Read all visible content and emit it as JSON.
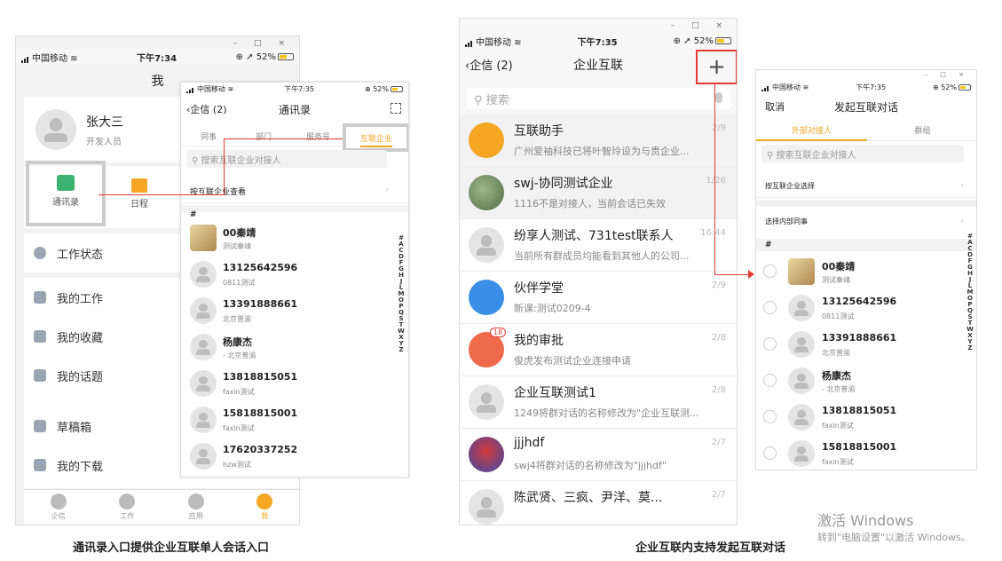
{
  "colors": {
    "accent": "#f5a623",
    "red": "#e53935",
    "gray_bg": "#f2f2f2"
  },
  "status": {
    "carrier": "中国移动",
    "time1": "下午7:34",
    "time2": "下午7:35",
    "time3": "下午7:35",
    "time4": "下午7:35",
    "battery": "52%"
  },
  "window_controls": "–  □  ×",
  "me": {
    "title": "我",
    "name": "张大三",
    "role": "开发人员",
    "shortcuts": [
      "通讯录",
      "日程"
    ],
    "menu": [
      "工作状态",
      "我的工作",
      "我的收藏",
      "我的话题",
      "草稿箱",
      "我的下载"
    ],
    "tabs": [
      "企信",
      "工作",
      "应用",
      "我"
    ]
  },
  "contacts": {
    "back": "企信 (2)",
    "title": "通讯录",
    "tabs": [
      "同事",
      "部门",
      "服务号",
      "互联企业"
    ],
    "search_placeholder": "搜索互联企业对接人",
    "browse": "按互联企业查看",
    "section": "#",
    "items": [
      {
        "name": "00秦靖",
        "sub": "测试秦靖"
      },
      {
        "name": "13125642596",
        "sub": "0811测试"
      },
      {
        "name": "13391888661",
        "sub": "北京普渝"
      },
      {
        "name": "杨康杰",
        "sub": "- 北京普渝"
      },
      {
        "name": "13818815051",
        "sub": "faxin测试"
      },
      {
        "name": "15818815001",
        "sub": "faxin测试"
      },
      {
        "name": "17620337252",
        "sub": "hzw测试"
      }
    ],
    "index": [
      "#",
      "A",
      "C",
      "D",
      "F",
      "G",
      "H",
      "J",
      "L",
      "M",
      "O",
      "P",
      "Q",
      "S",
      "T",
      "W",
      "X",
      "Y",
      "Z"
    ]
  },
  "interconnect": {
    "back": "企信 (2)",
    "title": "企业互联",
    "add": "+",
    "search": "搜索",
    "chats": [
      {
        "title": "互联助手",
        "sub": "广州爱袖科技已将叶智玲设为与贵企业...",
        "date": "2/9",
        "badge": ""
      },
      {
        "title": "swj-协同测试企业",
        "sub": "1116不是对接人，当前会话已失效",
        "date": "1/26",
        "badge": ""
      },
      {
        "title": "纷享人测试、731test联系人",
        "sub": "当前所有群成员均能看到其他人的公司...",
        "date": "16:44",
        "badge": ""
      },
      {
        "title": "伙伴学堂",
        "sub": "新课:测试0209-4",
        "date": "2/9",
        "badge": ""
      },
      {
        "title": "我的审批",
        "sub": "俊虎发布测试企业连接申请",
        "date": "2/8",
        "badge": "18"
      },
      {
        "title": "企业互联测试1",
        "sub": "1249将群对话的名称修改为\"企业互联测...",
        "date": "2/8",
        "badge": ""
      },
      {
        "title": "jjjhdf",
        "sub": "swj4将群对话的名称修改为\"jjjhdf\"",
        "date": "2/7",
        "badge": ""
      },
      {
        "title": "陈武贤、三疯、尹洋、莫...",
        "sub": "",
        "date": "2/7",
        "badge": ""
      }
    ]
  },
  "start": {
    "cancel": "取消",
    "title": "发起互联对话",
    "tabs": [
      "外部对接人",
      "群组"
    ],
    "search_placeholder": "搜索互联企业对接人",
    "rows": [
      "按互联企业选择",
      "选择内部同事"
    ],
    "section": "#",
    "items": [
      {
        "name": "00秦靖",
        "sub": "测试秦靖"
      },
      {
        "name": "13125642596",
        "sub": "0811测试"
      },
      {
        "name": "13391888661",
        "sub": "北京普渝"
      },
      {
        "name": "杨康杰",
        "sub": "- 北京普渝"
      },
      {
        "name": "13818815051",
        "sub": "faxin测试"
      },
      {
        "name": "15818815001",
        "sub": "faxin测试"
      }
    ],
    "index": [
      "#",
      "A",
      "C",
      "D",
      "F",
      "G",
      "H",
      "J",
      "L",
      "M",
      "O",
      "P",
      "Q",
      "S",
      "T",
      "W",
      "X",
      "Y",
      "Z"
    ]
  },
  "captions": {
    "left": "通讯录入口提供企业互联单人会话入口",
    "right": "企业互联内支持发起互联对话"
  },
  "watermark": {
    "line1": "激活 Windows",
    "line2": "转到\"电脑设置\"以激活 Windows。"
  }
}
